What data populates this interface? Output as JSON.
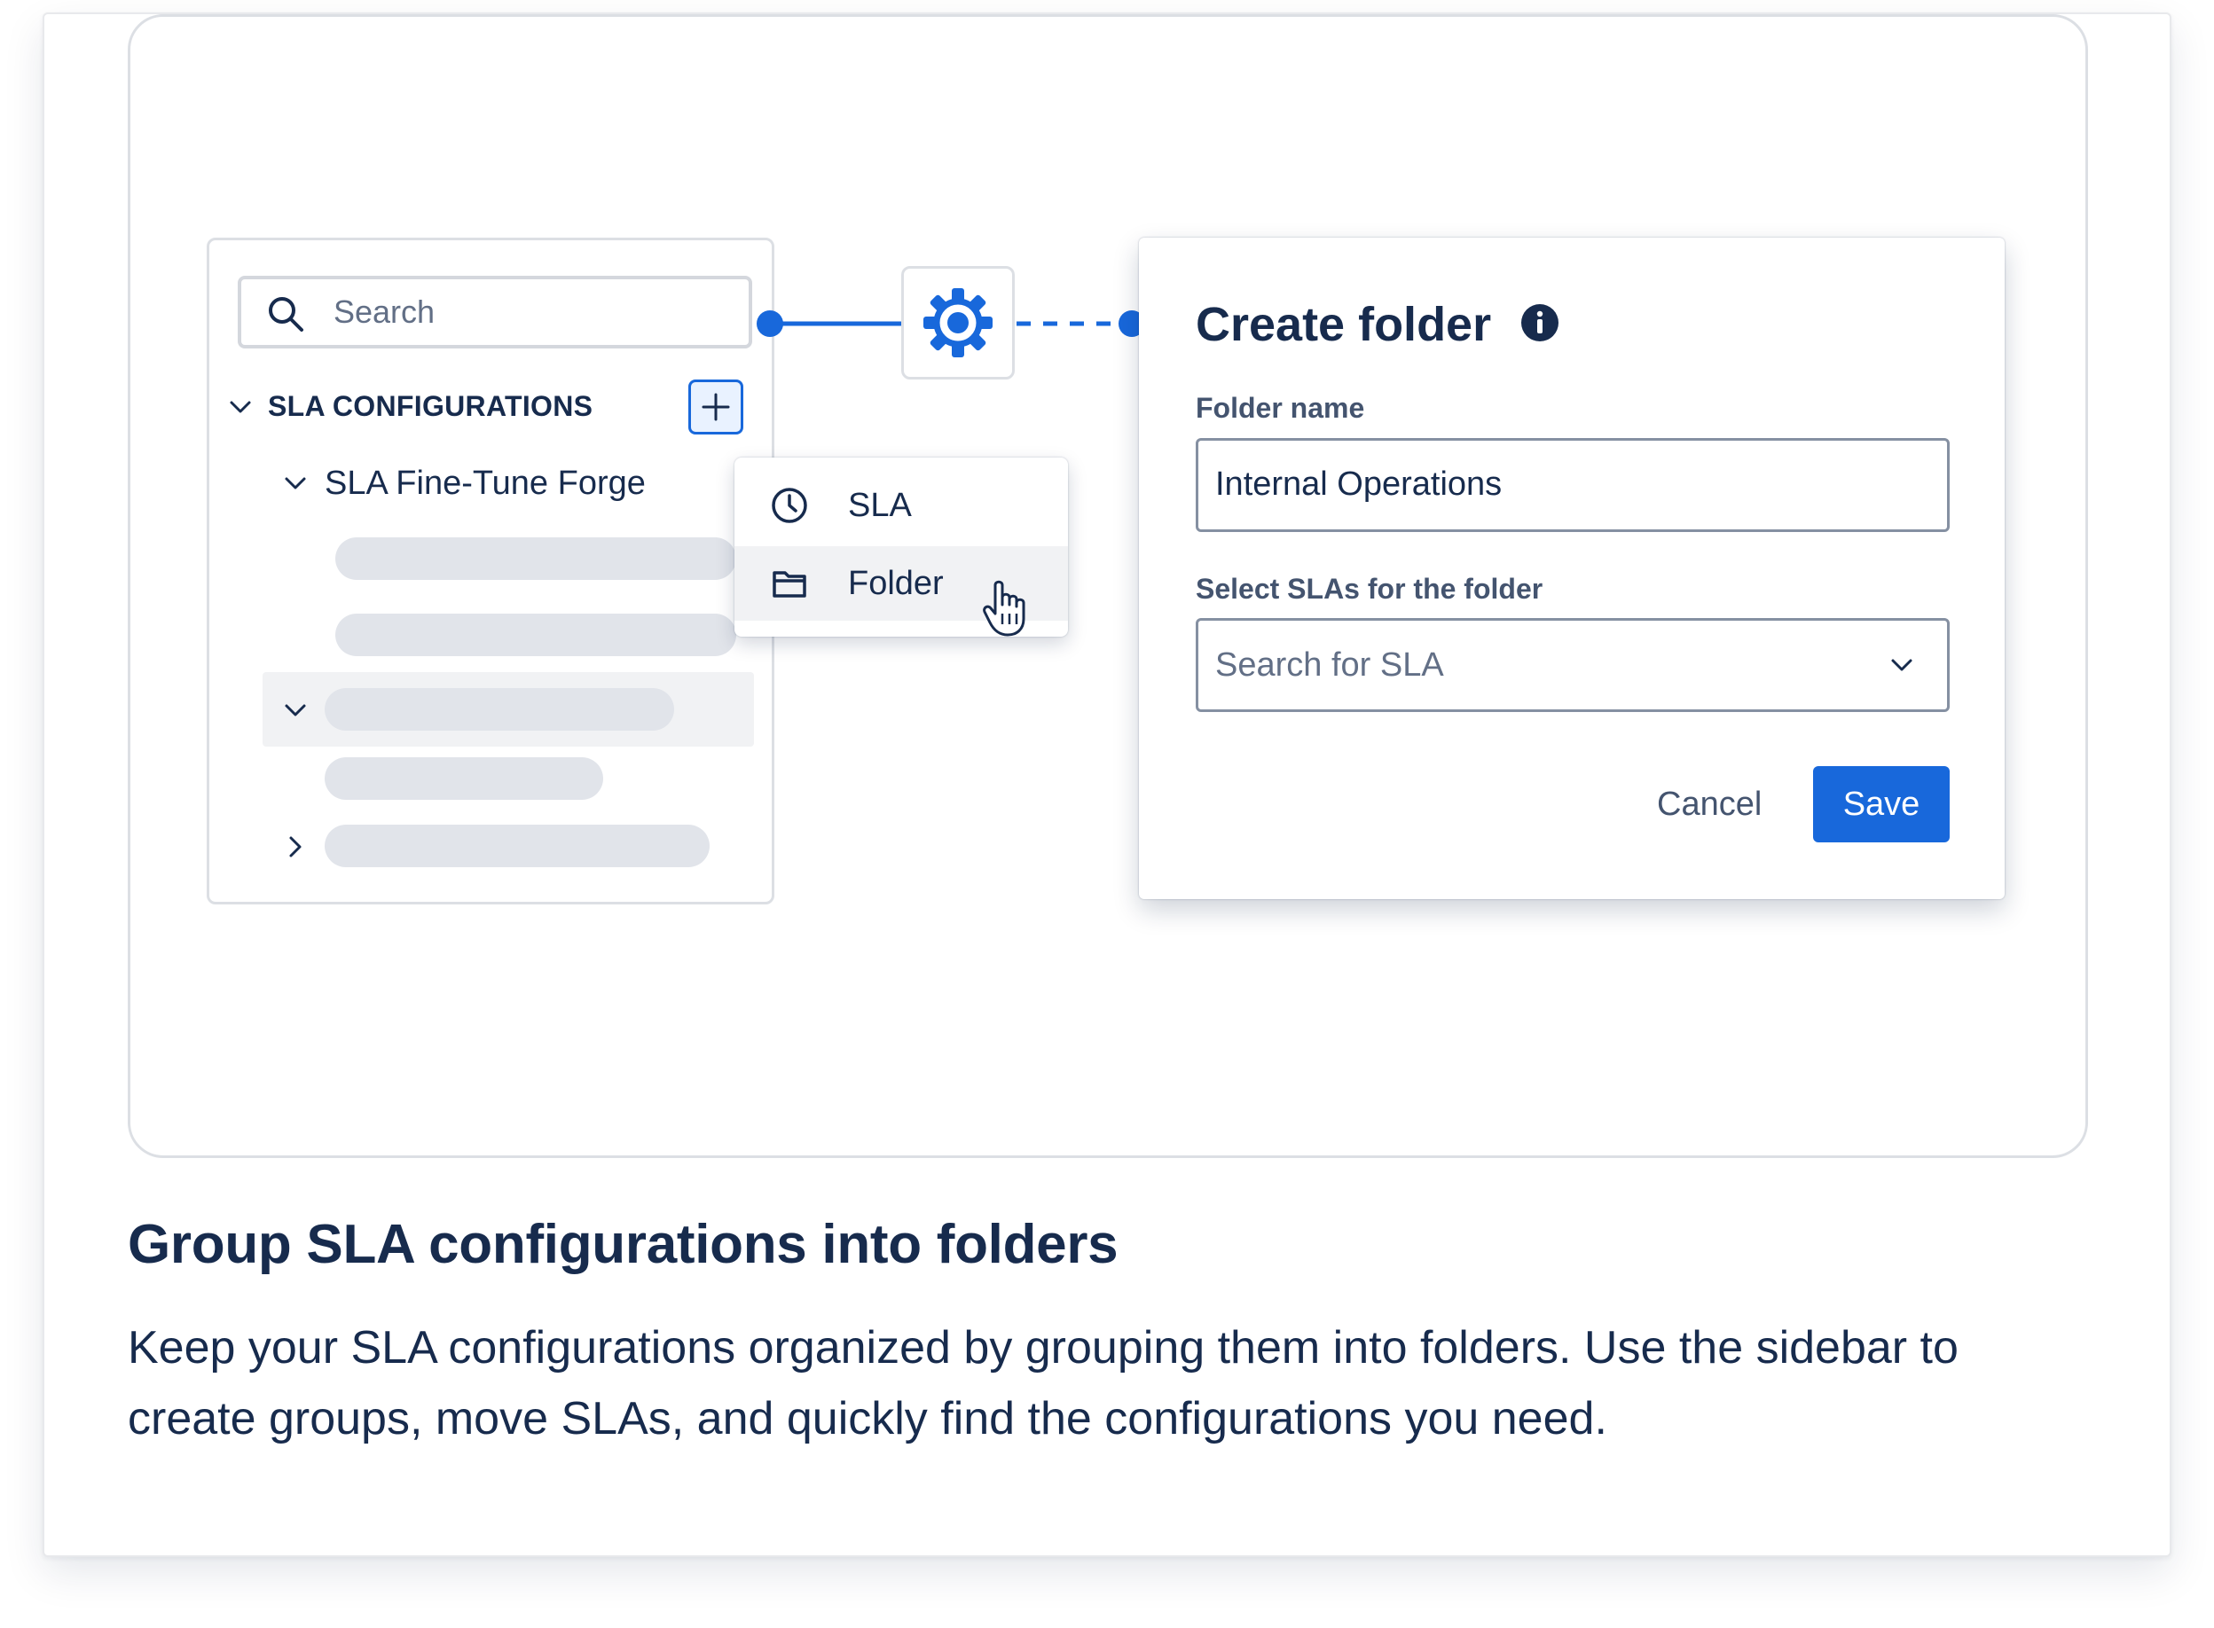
{
  "sidebar": {
    "search_placeholder": "Search",
    "section_title": "SLA CONFIGURATIONS",
    "add_button_icon": "plus-icon",
    "tree_item_label": "SLA Fine-Tune Forge"
  },
  "menu": {
    "items": [
      {
        "label": "SLA",
        "icon": "clock-icon"
      },
      {
        "label": "Folder",
        "icon": "folder-icon"
      }
    ]
  },
  "connector": {
    "icon": "gear-icon",
    "accent": "#1868db"
  },
  "modal": {
    "title": "Create folder",
    "folder_name_label": "Folder name",
    "folder_name_value": "Internal Operations",
    "select_label": "Select SLAs for the folder",
    "select_placeholder": "Search for SLA",
    "cancel_label": "Cancel",
    "save_label": "Save"
  },
  "feature": {
    "headline": "Group SLA configurations into folders",
    "description": "Keep your SLA configurations organized by grouping them into folders. Use the sidebar to create groups, move SLAs, and quickly find the configurations you need."
  },
  "colors": {
    "primary": "#1868db",
    "text": "#172b4d",
    "skeleton": "#e1e4ea"
  }
}
